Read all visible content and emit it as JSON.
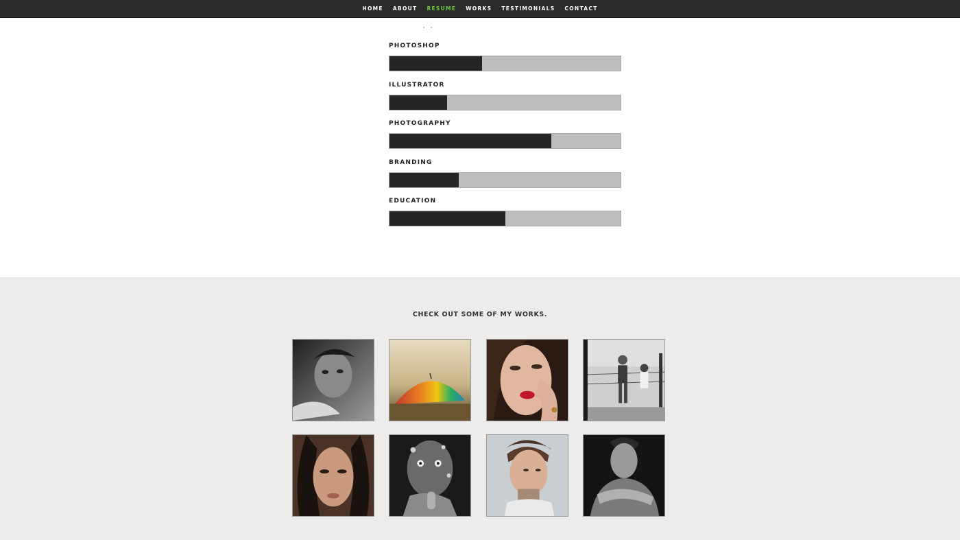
{
  "nav": {
    "items": [
      {
        "label": "HOME",
        "active": false
      },
      {
        "label": "ABOUT",
        "active": false
      },
      {
        "label": "RESUME",
        "active": true
      },
      {
        "label": "WORKS",
        "active": false
      },
      {
        "label": "TESTIMONIALS",
        "active": false
      },
      {
        "label": "CONTACT",
        "active": false
      }
    ],
    "active_color": "#6cc644"
  },
  "skills": [
    {
      "label": "PHOTOSHOP",
      "percent": 40
    },
    {
      "label": "ILLUSTRATOR",
      "percent": 25
    },
    {
      "label": "PHOTOGRAPHY",
      "percent": 70
    },
    {
      "label": "BRANDING",
      "percent": 30
    },
    {
      "label": "EDUCATION",
      "percent": 50
    }
  ],
  "works": {
    "title": "CHECK OUT SOME OF MY WORKS.",
    "items": [
      {
        "name": "bw-boy-portrait"
      },
      {
        "name": "rainbow-umbrella"
      },
      {
        "name": "woman-red-lips"
      },
      {
        "name": "boxing-kids"
      },
      {
        "name": "woman-portrait"
      },
      {
        "name": "painted-child"
      },
      {
        "name": "man-tattoo-neck"
      },
      {
        "name": "bw-young-man"
      }
    ]
  }
}
